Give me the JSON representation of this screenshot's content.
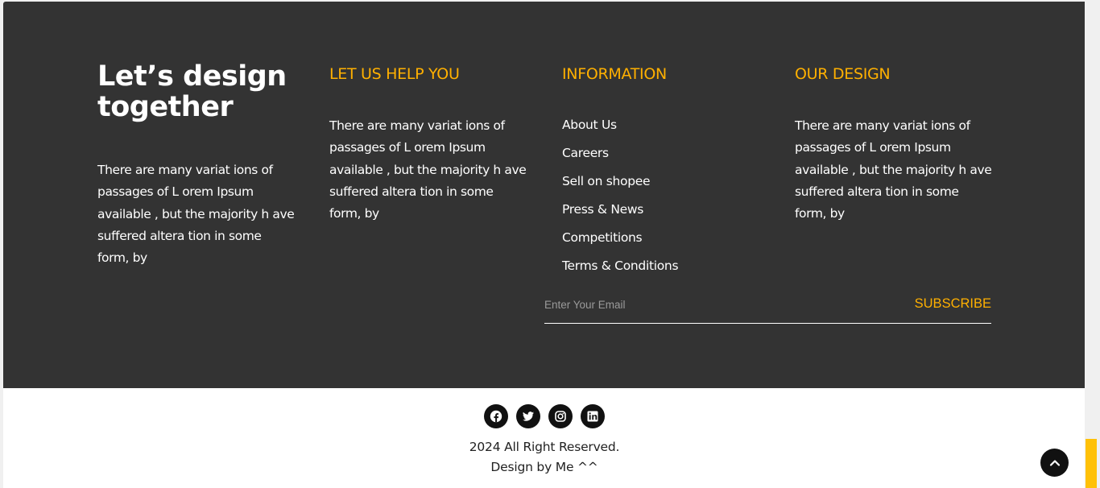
{
  "brand": {
    "title": "Let’s design together",
    "description": "There are many variat ions of passages of L orem Ipsum available , but the majority h ave suffered altera tion in some form, by"
  },
  "help": {
    "heading": "LET US HELP YOU",
    "description": "There are many variat ions of passages of L orem Ipsum available , but the majority h ave suffered altera tion in some form, by"
  },
  "information": {
    "heading": "INFORMATION",
    "links": [
      "About Us",
      "Careers",
      "Sell on shopee",
      "Press & News",
      "Competitions",
      "Terms & Conditions"
    ]
  },
  "design": {
    "heading": "OUR DESIGN",
    "description": "There are many variat ions of passages of L orem Ipsum available , but the majority h ave suffered altera tion in some form, by"
  },
  "subscribe": {
    "placeholder": "Enter Your Email",
    "button_label": "SUBSCRIBE"
  },
  "socials": [
    {
      "icon": "facebook-icon"
    },
    {
      "icon": "twitter-icon"
    },
    {
      "icon": "instagram-icon"
    },
    {
      "icon": "linkedin-icon"
    }
  ],
  "bottom": {
    "copyright": "2024 All Right Reserved.",
    "credit": "Design by Me ^^"
  },
  "back_to_top": {
    "icon": "chevron-up-icon"
  },
  "colors": {
    "footer_bg": "#333333",
    "accent": "#ffb000",
    "text": "#ffffff",
    "bottom_bg": "#ffffff",
    "icon_bg": "#111111",
    "scroll_thumb": "#ffc107"
  }
}
